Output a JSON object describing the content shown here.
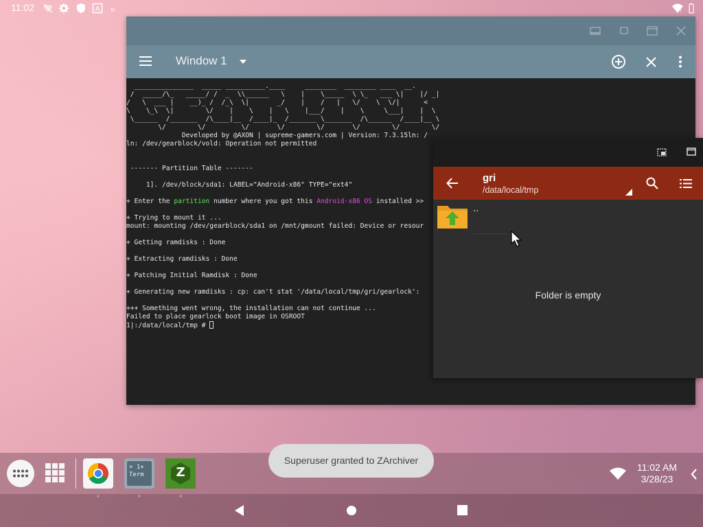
{
  "status_bar": {
    "time": "11:02",
    "icons": [
      "wifi-off-icon",
      "settings-icon",
      "shield-icon",
      "a-box-icon",
      "dot-icon",
      "wifi-icon",
      "battery-icon"
    ]
  },
  "terminal": {
    "window_title": "Window 1",
    "lines": [
      "  _______________  _____ __________.____     ________  ________ ____  __.",
      " /  _____/\\_   _____/ /  _  \\\\______   \\    |    \\_____  \\ \\_   ___ \\|    |/ _|",
      "/   \\  ___ |    __)_ /  /_\\  \\|       _/    |    /   |   \\/    \\  \\/|      <",
      "\\    \\_\\  \\|        \\/    |    \\    |   \\    |___/    |    \\     \\___|    |  \\",
      " \\______  /_______  /\\____|__  /____|_  /_______ \\_______  /\\______  /____|__ \\",
      "        \\/        \\/         \\/       \\/        \\/       \\/        \\/        \\/",
      "              Developed by @AXON | supreme-gamers.com | Version: 7.3.15ln: /",
      "ln: /dev/gearblock/vold: Operation not permitted",
      "",
      "",
      " ------- Partition Table -------",
      "",
      "     1]. /dev/block/sda1: LABEL=\"Android-x86\" TYPE=\"ext4\"",
      "",
      "+ Enter the {partition} number where you got this {Android-x86 OS} installed >>",
      "",
      "+ Trying to mount it ...",
      "mount: mounting /dev/gearblock/sda1 on /mnt/gmount failed: Device or resour",
      "",
      "+ Getting ramdisks : Done",
      "",
      "+ Extracting ramdisks : Done",
      "",
      "+ Patching Initial Ramdisk : Done",
      "",
      "+ Generating new ramdisks : cp: can't stat '/data/local/tmp/gri/gearlock':",
      "",
      "+++ Something went wrong, the installation can not continue ...",
      "Failed to place gearlock boot image in OSROOT",
      "1|:/data/local/tmp # "
    ],
    "highlights": {
      "partition": "partition",
      "os": "Android-x86 OS"
    }
  },
  "file_manager": {
    "folder_name": "gri",
    "path": "/data/local/tmp",
    "up_item_label": "..",
    "empty_message": "Folder is empty"
  },
  "taskbar": {
    "apps": [
      {
        "name": "Chrome",
        "icon": "chrome-icon"
      },
      {
        "name": "Terminal",
        "icon_text": "> 1+\nTerm"
      },
      {
        "name": "ZArchiver",
        "icon_text": "Z"
      }
    ],
    "toast": "Superuser granted to ZArchiver",
    "clock_time": "11:02 AM",
    "clock_date": "3/28/23"
  },
  "colors": {
    "terminal_titlebar": "#637d8c",
    "terminal_appbar": "#6f8a99",
    "terminal_bg": "#212121",
    "fm_appbar": "#8e2a14",
    "fm_bg": "#2e2e2e",
    "green": "#5ee65e",
    "magenta": "#e24fe2"
  }
}
